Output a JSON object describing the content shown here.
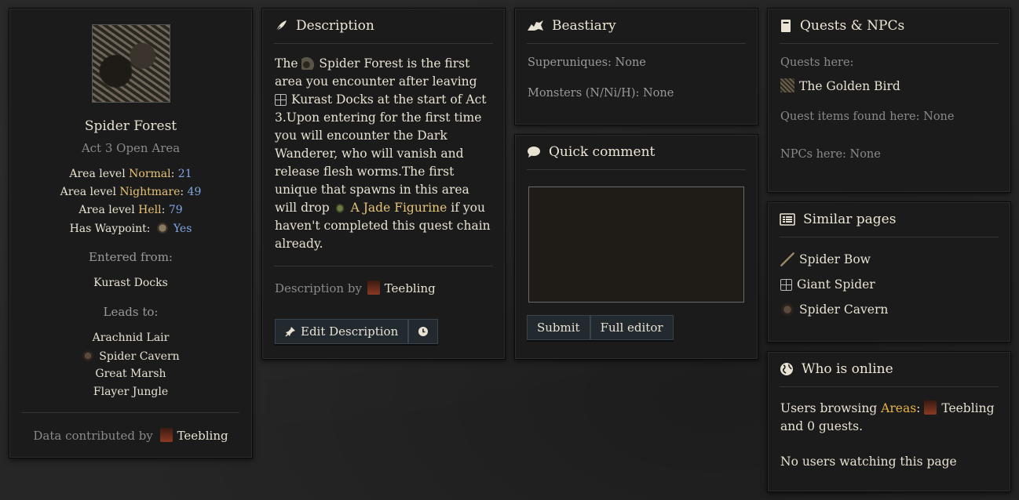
{
  "area": {
    "name": "Spider Forest",
    "type": "Act 3 Open Area",
    "levels": [
      {
        "label": "Area level",
        "difficulty": "Normal",
        "value": "21"
      },
      {
        "label": "Area level",
        "difficulty": "Nightmare",
        "value": "49"
      },
      {
        "label": "Area level",
        "difficulty": "Hell",
        "value": "79"
      }
    ],
    "waypoint_label": "Has Waypoint:",
    "waypoint_value": "Yes",
    "entered_label": "Entered from:",
    "entered_from": "Kurast Docks",
    "leads_label": "Leads to:",
    "leads_to": [
      "Arachnid Lair",
      "Spider Cavern",
      "Great Marsh",
      "Flayer Jungle"
    ],
    "contrib_label": "Data contributed by",
    "contrib_user": "Teebling"
  },
  "description": {
    "title": "Description",
    "part1": "The ",
    "link_area": "Spider Forest",
    "part2": " is the first area you encounter after leaving ",
    "link_docks": "Kurast Docks",
    "part3": " at the start of Act 3.Upon entering for the first time you will encounter the Dark Wanderer, who will vanish and release flesh worms.The first unique that spawns in this area will drop ",
    "link_item": "A Jade Figurine",
    "part4": " if you haven't completed this quest chain already.",
    "by_label": "Description by",
    "by_user": "Teebling",
    "edit_button": "Edit Description"
  },
  "bestiary": {
    "title": "Beastiary",
    "superuniques_label": "Superuniques:",
    "superuniques_value": "None",
    "monsters_label": "Monsters (N/Ni/H):",
    "monsters_value": "None"
  },
  "quick_comment": {
    "title": "Quick comment",
    "textarea_value": "",
    "submit": "Submit",
    "full_editor": "Full editor"
  },
  "quests": {
    "title": "Quests & NPCs",
    "quests_label": "Quests here:",
    "quest": "The Golden Bird",
    "items_label": "Quest items found here:",
    "items_value": "None",
    "npcs_label": "NPCs here:",
    "npcs_value": "None"
  },
  "similar": {
    "title": "Similar pages",
    "items": [
      "Spider Bow",
      "Giant Spider",
      "Spider Cavern"
    ]
  },
  "online": {
    "title": "Who is online",
    "browsing_label": "Users browsing",
    "section": "Areas",
    "user": "Teebling",
    "guests": "and 0 guests.",
    "watching": "No users watching this page"
  },
  "colors": {
    "gold": "#e7c477",
    "blue": "#7fa6e0",
    "muted": "#8a8a8a"
  }
}
